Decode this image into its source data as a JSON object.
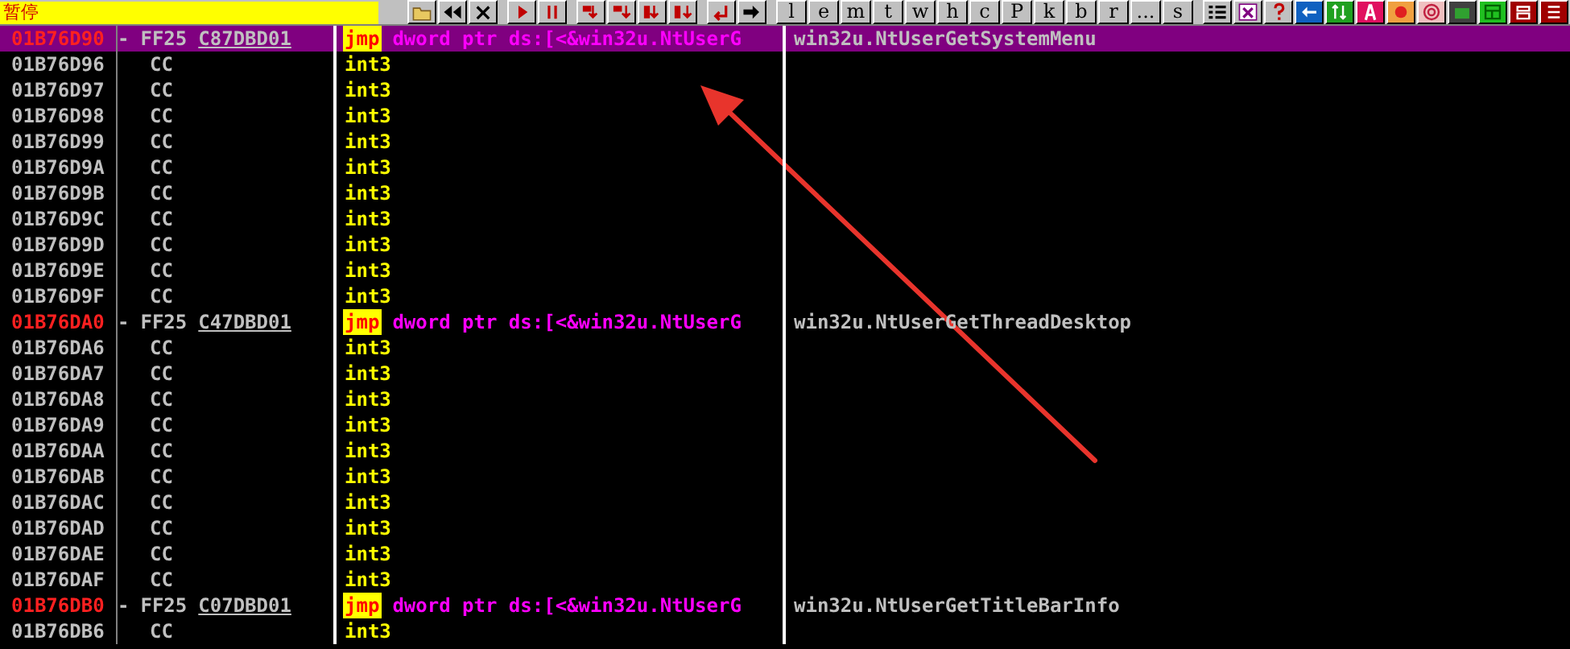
{
  "status": "暂停",
  "toolbar_letters": [
    "l",
    "e",
    "m",
    "t",
    "w",
    "h",
    "c",
    "P",
    "k",
    "b",
    "r",
    "...",
    "s"
  ],
  "rows": [
    {
      "address": "01B76D90",
      "kind": "jump",
      "marker": "-",
      "opcode": "FF25",
      "operand_bytes": "C87DBD01",
      "mnemonic": "jmp",
      "operand": "dword ptr ds:[<&win32u.NtUserG",
      "comment": "win32u.NtUserGetSystemMenu",
      "selected": true
    },
    {
      "address": "01B76D96",
      "kind": "pad",
      "opcode": "CC",
      "mnemonic": "int3",
      "selected": false
    },
    {
      "address": "01B76D97",
      "kind": "pad",
      "opcode": "CC",
      "mnemonic": "int3",
      "selected": false
    },
    {
      "address": "01B76D98",
      "kind": "pad",
      "opcode": "CC",
      "mnemonic": "int3",
      "selected": false
    },
    {
      "address": "01B76D99",
      "kind": "pad",
      "opcode": "CC",
      "mnemonic": "int3",
      "selected": false
    },
    {
      "address": "01B76D9A",
      "kind": "pad",
      "opcode": "CC",
      "mnemonic": "int3",
      "selected": false
    },
    {
      "address": "01B76D9B",
      "kind": "pad",
      "opcode": "CC",
      "mnemonic": "int3",
      "selected": false
    },
    {
      "address": "01B76D9C",
      "kind": "pad",
      "opcode": "CC",
      "mnemonic": "int3",
      "selected": false
    },
    {
      "address": "01B76D9D",
      "kind": "pad",
      "opcode": "CC",
      "mnemonic": "int3",
      "selected": false
    },
    {
      "address": "01B76D9E",
      "kind": "pad",
      "opcode": "CC",
      "mnemonic": "int3",
      "selected": false
    },
    {
      "address": "01B76D9F",
      "kind": "pad",
      "opcode": "CC",
      "mnemonic": "int3",
      "selected": false
    },
    {
      "address": "01B76DA0",
      "kind": "jump",
      "marker": "-",
      "opcode": "FF25",
      "operand_bytes": "C47DBD01",
      "mnemonic": "jmp",
      "operand": "dword ptr ds:[<&win32u.NtUserG",
      "comment": "win32u.NtUserGetThreadDesktop",
      "selected": false
    },
    {
      "address": "01B76DA6",
      "kind": "pad",
      "opcode": "CC",
      "mnemonic": "int3",
      "selected": false
    },
    {
      "address": "01B76DA7",
      "kind": "pad",
      "opcode": "CC",
      "mnemonic": "int3",
      "selected": false
    },
    {
      "address": "01B76DA8",
      "kind": "pad",
      "opcode": "CC",
      "mnemonic": "int3",
      "selected": false
    },
    {
      "address": "01B76DA9",
      "kind": "pad",
      "opcode": "CC",
      "mnemonic": "int3",
      "selected": false
    },
    {
      "address": "01B76DAA",
      "kind": "pad",
      "opcode": "CC",
      "mnemonic": "int3",
      "selected": false
    },
    {
      "address": "01B76DAB",
      "kind": "pad",
      "opcode": "CC",
      "mnemonic": "int3",
      "selected": false
    },
    {
      "address": "01B76DAC",
      "kind": "pad",
      "opcode": "CC",
      "mnemonic": "int3",
      "selected": false
    },
    {
      "address": "01B76DAD",
      "kind": "pad",
      "opcode": "CC",
      "mnemonic": "int3",
      "selected": false
    },
    {
      "address": "01B76DAE",
      "kind": "pad",
      "opcode": "CC",
      "mnemonic": "int3",
      "selected": false
    },
    {
      "address": "01B76DAF",
      "kind": "pad",
      "opcode": "CC",
      "mnemonic": "int3",
      "selected": false
    },
    {
      "address": "01B76DB0",
      "kind": "jump",
      "marker": "-",
      "opcode": "FF25",
      "operand_bytes": "C07DBD01",
      "mnemonic": "jmp",
      "operand": "dword ptr ds:[<&win32u.NtUserG",
      "comment": "win32u.NtUserGetTitleBarInfo",
      "selected": false
    },
    {
      "address": "01B76DB6",
      "kind": "pad",
      "opcode": "CC",
      "mnemonic": "int3",
      "selected": false
    }
  ]
}
